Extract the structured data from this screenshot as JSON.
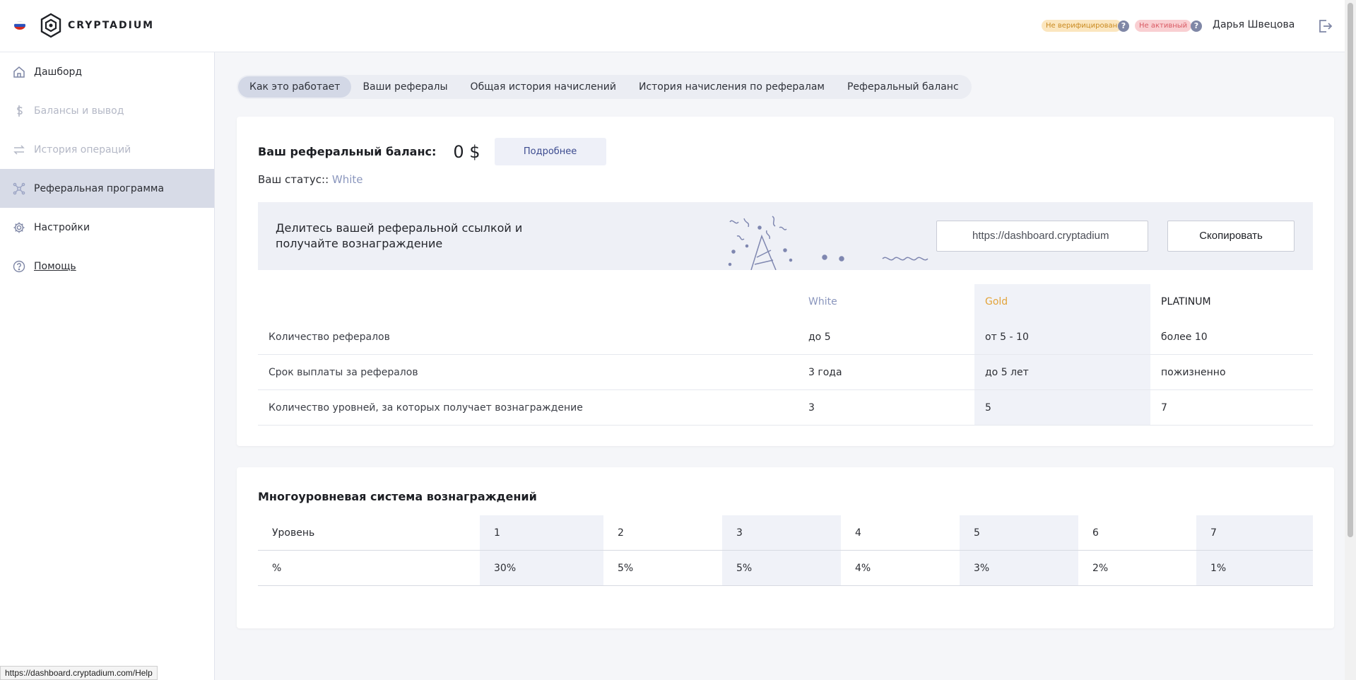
{
  "header": {
    "brand": "CRYPTADIUM",
    "badge_verification": "Не верифицирован",
    "badge_active": "Не активный",
    "user_name": "Дарья Швецова"
  },
  "sidebar": {
    "items": [
      {
        "label": "Дашборд",
        "icon": "home-icon"
      },
      {
        "label": "Балансы и вывод",
        "icon": "dollar-icon"
      },
      {
        "label": "История операций",
        "icon": "arrows-icon"
      },
      {
        "label": "Реферальная программа",
        "icon": "network-icon"
      },
      {
        "label": "Настройки",
        "icon": "gear-icon"
      },
      {
        "label": "Помощь",
        "icon": "help-circle-icon"
      }
    ]
  },
  "tabs": [
    "Как это работает",
    "Ваши рефералы",
    "Общая история начислений",
    "История начисления по рефералам",
    "Реферальный баланс"
  ],
  "balance": {
    "label": "Ваш реферальный баланс:",
    "value": "0 $",
    "more_button": "Подробнее",
    "status_label": "Ваш статус::",
    "status_value": "White"
  },
  "share": {
    "text": "Делитесь вашей реферальной ссылкой и получайте вознаграждение",
    "link": "https://dashboard.cryptadium",
    "copy_button": "Скопировать"
  },
  "tiers": {
    "headers": [
      "White",
      "Gold",
      "PLATINUM"
    ],
    "rows": [
      {
        "label": "Количество рефералов",
        "values": [
          "до 5",
          "от 5 - 10",
          "более 10"
        ]
      },
      {
        "label": "Срок выплаты за рефералов",
        "values": [
          "3 года",
          "до 5 лет",
          "пожизненно"
        ]
      },
      {
        "label": "Количество уровней, за которых получает вознаграждение",
        "values": [
          "3",
          "5",
          "7"
        ]
      }
    ]
  },
  "multilevel": {
    "title": "Многоуровневая система вознаграждений",
    "level_label": "Уровень",
    "percent_label": "%",
    "levels": [
      "1",
      "2",
      "3",
      "4",
      "5",
      "6",
      "7"
    ],
    "percents": [
      "30%",
      "5%",
      "5%",
      "4%",
      "3%",
      "2%",
      "1%"
    ]
  },
  "status_bar_url": "https://dashboard.cryptadium.com/Help",
  "colors": {
    "accent": "#8a96bd",
    "gold": "#e3a43a",
    "active_nav": "#d7dbe7"
  }
}
